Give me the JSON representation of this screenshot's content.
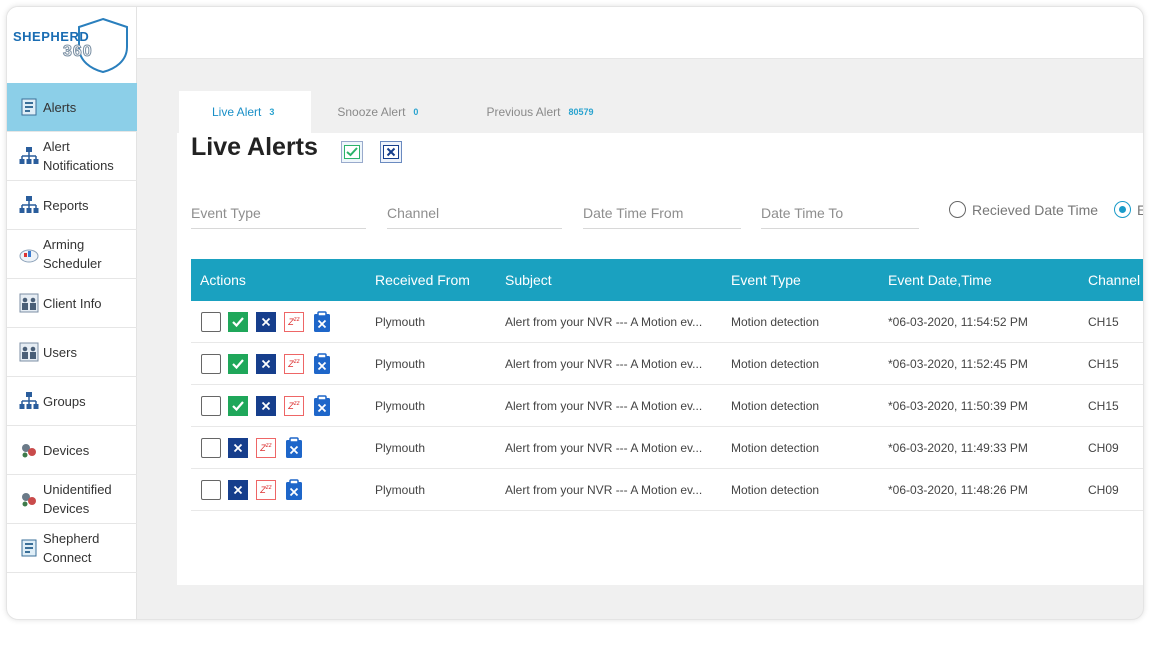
{
  "brand": {
    "line1": "SHEPHERD",
    "line2": "360"
  },
  "sidebar": {
    "items": [
      {
        "label": "Alerts",
        "icon": "alerts-icon",
        "active": true
      },
      {
        "label": "Alert\nNotifications",
        "icon": "network-icon"
      },
      {
        "label": "Reports",
        "icon": "network-icon"
      },
      {
        "label": "Arming\nScheduler",
        "icon": "scheduler-icon"
      },
      {
        "label": "Client Info",
        "icon": "people-icon"
      },
      {
        "label": "Users",
        "icon": "people-icon"
      },
      {
        "label": "Groups",
        "icon": "network-icon"
      },
      {
        "label": "Devices",
        "icon": "devices-icon"
      },
      {
        "label": "Unidentified\nDevices",
        "icon": "devices-icon"
      },
      {
        "label": "Shepherd\nConnect",
        "icon": "alerts-icon"
      }
    ]
  },
  "tabs": [
    {
      "label": "Live Alert",
      "count": "3",
      "active": true
    },
    {
      "label": "Snooze Alert",
      "count": "0"
    },
    {
      "label": "Previous Alert",
      "count": "80579"
    }
  ],
  "title": "Live Alerts",
  "filters": {
    "event_type": "Event Type",
    "channel": "Channel",
    "date_from": "Date Time From",
    "date_to": "Date Time To",
    "radio_received": "Recieved Date Time",
    "radio_event": "E"
  },
  "table": {
    "headers": {
      "actions": "Actions",
      "received_from": "Received From",
      "subject": "Subject",
      "event_type": "Event Type",
      "event_date": "Event Date,Time",
      "channel": "Channel"
    },
    "rows": [
      {
        "from": "Plymouth",
        "subject": "Alert from your NVR --- A Motion ev...",
        "type": "Motion detection",
        "date": "*06-03-2020, 11:54:52 PM",
        "channel": "CH15",
        "acknowledge": true
      },
      {
        "from": "Plymouth",
        "subject": "Alert from your NVR --- A Motion ev...",
        "type": "Motion detection",
        "date": "*06-03-2020, 11:52:45 PM",
        "channel": "CH15",
        "acknowledge": true
      },
      {
        "from": "Plymouth",
        "subject": "Alert from your NVR --- A Motion ev...",
        "type": "Motion detection",
        "date": "*06-03-2020, 11:50:39 PM",
        "channel": "CH15",
        "acknowledge": true
      },
      {
        "from": "Plymouth",
        "subject": "Alert from your NVR --- A Motion ev...",
        "type": "Motion detection",
        "date": "*06-03-2020, 11:49:33 PM",
        "channel": "CH09",
        "acknowledge": false
      },
      {
        "from": "Plymouth",
        "subject": "Alert from your NVR --- A Motion ev...",
        "type": "Motion detection",
        "date": "*06-03-2020, 11:48:26 PM",
        "channel": "CH09",
        "acknowledge": false
      }
    ]
  },
  "icons": {
    "snooze_glyph": "Z",
    "snooze_sup": "zz"
  },
  "colors": {
    "accent": "#1aa1c0",
    "active_nav": "#8ccfe8",
    "ok": "#1fa75a",
    "dismiss": "#163e8c"
  }
}
